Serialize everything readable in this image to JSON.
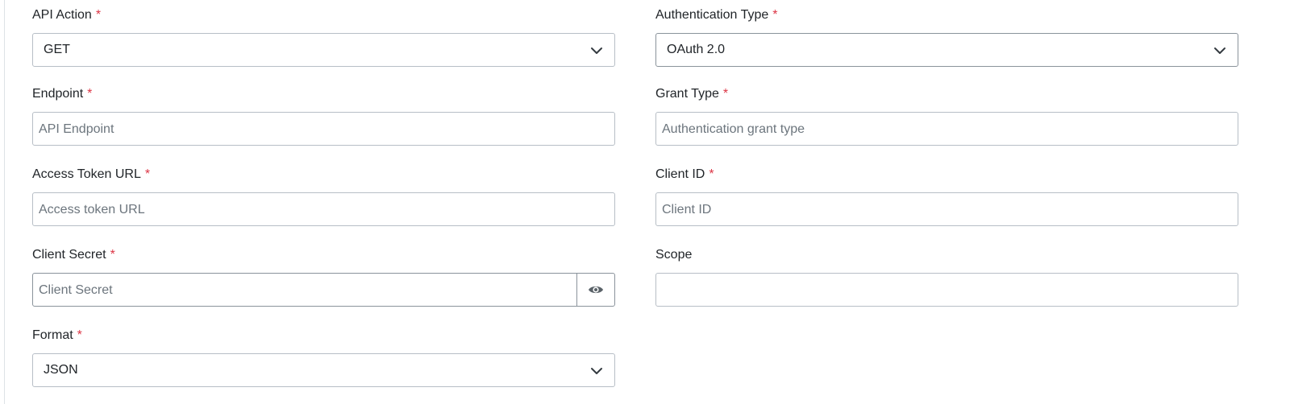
{
  "form": {
    "required_mark": "*",
    "api_action": {
      "label": "API Action",
      "value": "GET"
    },
    "auth_type": {
      "label": "Authentication Type",
      "value": "OAuth 2.0"
    },
    "endpoint": {
      "label": "Endpoint",
      "placeholder": "API Endpoint"
    },
    "grant_type": {
      "label": "Grant Type",
      "placeholder": "Authentication grant type"
    },
    "access_token_url": {
      "label": "Access Token URL",
      "placeholder": "Access token URL"
    },
    "client_id": {
      "label": "Client ID",
      "placeholder": "Client ID"
    },
    "client_secret": {
      "label": "Client Secret",
      "placeholder": "Client Secret"
    },
    "scope": {
      "label": "Scope",
      "placeholder": ""
    },
    "format": {
      "label": "Format",
      "value": "JSON"
    }
  },
  "icons": {
    "chevron": "chevron-down-icon",
    "eye": "eye-icon"
  },
  "colors": {
    "required": "#dc3545",
    "border": "#b7bec6",
    "placeholder": "#6c757d",
    "text": "#212529"
  }
}
